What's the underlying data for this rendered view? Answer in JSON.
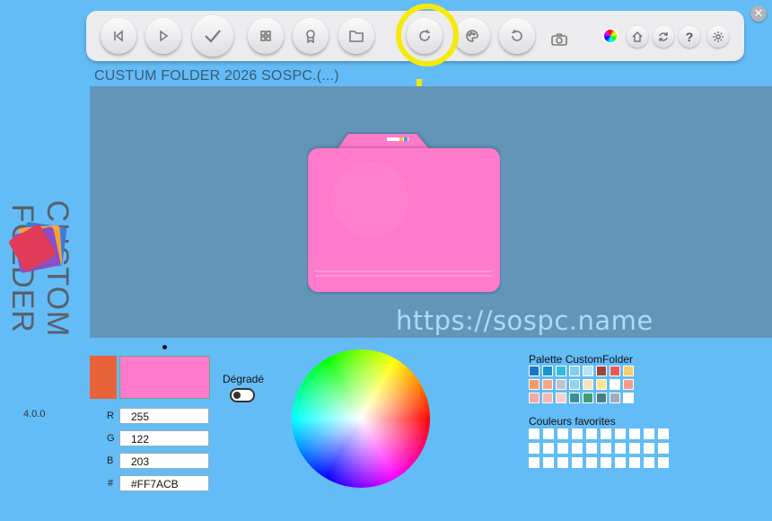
{
  "app": {
    "window_title": "CUSTUM FOLDER 2026 SOSPC.(...)",
    "side_title": "CUSTOM FOLDER",
    "version": "4.0.0",
    "watermark_url": "https://sospc.name"
  },
  "toolbar": {
    "buttons": [
      "skip-back",
      "play",
      "check",
      "grid",
      "badge",
      "folder",
      "redo",
      "palette",
      "undo",
      "camera"
    ],
    "highlighted": "redo",
    "small_buttons": [
      "color-wheel",
      "home",
      "refresh",
      "help",
      "settings"
    ],
    "help_label": "?"
  },
  "colors": {
    "old_color": "#e8623a",
    "new_color": "#ff7acb",
    "background": "#63bcf6",
    "preview_bg": "#6295b8",
    "highlight_ring": "#f5ea0c"
  },
  "color_picker": {
    "r_label": "R",
    "g_label": "G",
    "b_label": "B",
    "hex_label": "#",
    "r": "255",
    "g": "122",
    "b": "203",
    "hex": "#FF7ACB",
    "gradient_label": "Dégradé",
    "gradient_enabled": false
  },
  "palette": {
    "title": "Palette CustomFolder",
    "rows": [
      [
        "#1878be",
        "#1a93c9",
        "#2ebce0",
        "#7fd0ea",
        "#b6e4f4",
        "#a2403c",
        "#e85a50",
        "#f8c96e"
      ],
      [
        "#f49a66",
        "#f6a882",
        "#c0c4c9",
        "#8fd4e8",
        "#fbe3c0",
        "#fde58e",
        "#ffffff",
        "#f69a8a"
      ],
      [
        "#f6a69c",
        "#f8b4ae",
        "#fbd0cc",
        "#3b8e93",
        "#3f9c78",
        "#4c7a8c",
        "#a6abb0",
        "#ffffff"
      ]
    ],
    "favorites_title": "Couleurs favorites"
  }
}
